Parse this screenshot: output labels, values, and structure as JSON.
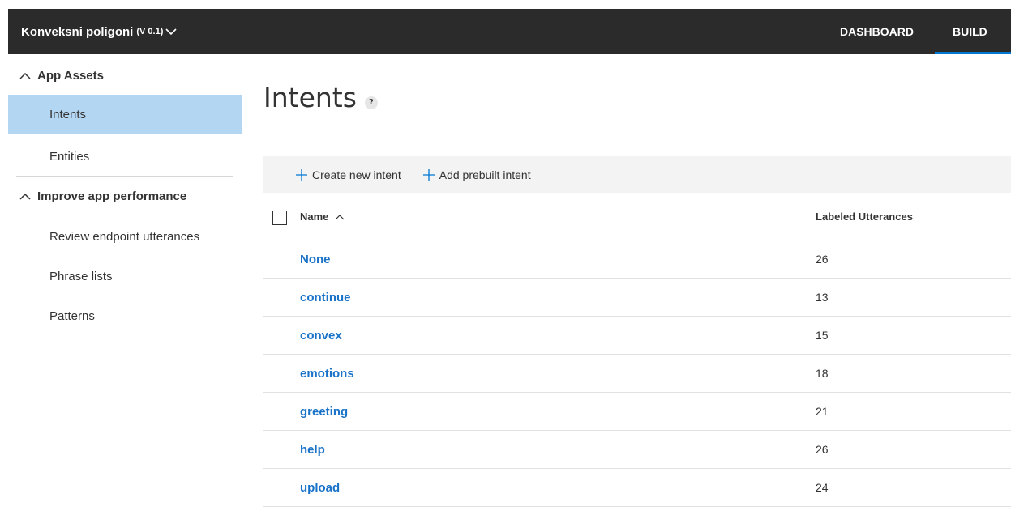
{
  "header": {
    "app_name": "Konveksni poligoni",
    "app_version": "(V 0.1)",
    "nav": [
      {
        "label": "DASHBOARD",
        "active": false
      },
      {
        "label": "BUILD",
        "active": true
      }
    ],
    "background_color": "#2b2b2b",
    "accent_color": "#0078d4"
  },
  "sidebar": {
    "sections": [
      {
        "title": "App Assets",
        "expanded": true,
        "items": [
          {
            "label": "Intents",
            "active": true
          },
          {
            "label": "Entities",
            "active": false
          }
        ]
      },
      {
        "title": "Improve app performance",
        "expanded": true,
        "items": [
          {
            "label": "Review endpoint utterances",
            "active": false
          },
          {
            "label": "Phrase lists",
            "active": false
          },
          {
            "label": "Patterns",
            "active": false
          }
        ]
      }
    ],
    "active_color": "#b3d7f2"
  },
  "main": {
    "title": "Intents",
    "help_badge": "?",
    "commands": [
      {
        "label": "Create new intent",
        "icon": "plus-icon"
      },
      {
        "label": "Add prebuilt intent",
        "icon": "plus-icon"
      }
    ],
    "table": {
      "columns": [
        {
          "label": "Name",
          "sort": "ascending"
        },
        {
          "label": "Labeled Utterances"
        }
      ],
      "rows": [
        {
          "name": "None",
          "labeled_utterances": "26"
        },
        {
          "name": "continue",
          "labeled_utterances": "13"
        },
        {
          "name": "convex",
          "labeled_utterances": "15"
        },
        {
          "name": "emotions",
          "labeled_utterances": "18"
        },
        {
          "name": "greeting",
          "labeled_utterances": "21"
        },
        {
          "name": "help",
          "labeled_utterances": "26"
        },
        {
          "name": "upload",
          "labeled_utterances": "24"
        }
      ],
      "link_color": "#1a73c8"
    }
  }
}
